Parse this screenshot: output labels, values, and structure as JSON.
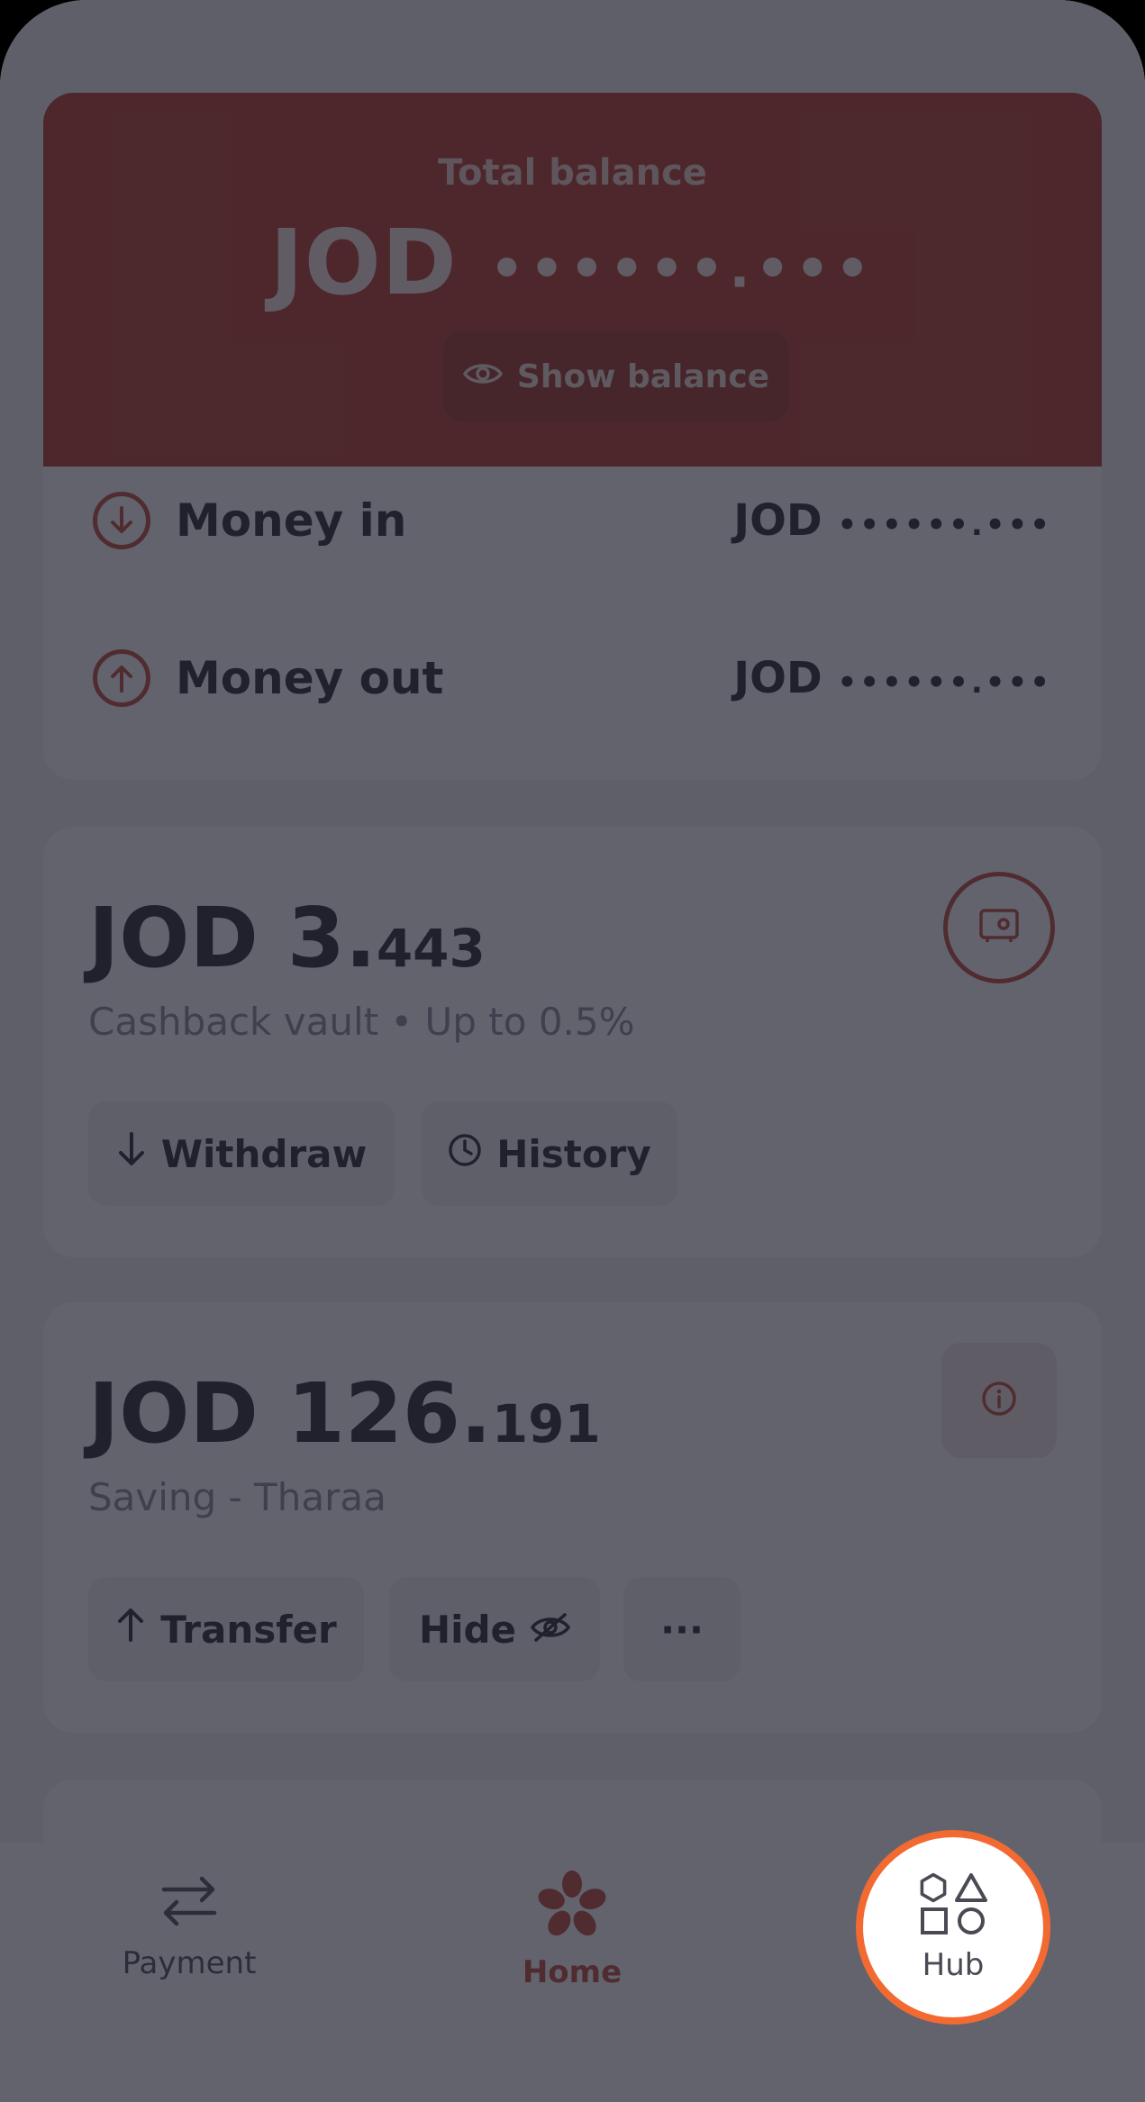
{
  "balance": {
    "label": "Total balance",
    "currency": "JOD",
    "masked": "••••••.•••",
    "show_label": "Show balance"
  },
  "flow": {
    "money_in_label": "Money in",
    "money_in_currency": "JOD",
    "money_in_masked": "••••••.•••",
    "money_out_label": "Money out",
    "money_out_currency": "JOD",
    "money_out_masked": "••••••.•••"
  },
  "vault": {
    "amount_main": "JOD 3.",
    "amount_decimals": "443",
    "subtitle": "Cashback vault • Up to 0.5%",
    "withdraw_label": "Withdraw",
    "history_label": "History"
  },
  "saving": {
    "amount_main": "JOD 126.",
    "amount_decimals": "191",
    "subtitle": "Saving - Tharaa",
    "transfer_label": "Transfer",
    "hide_label": "Hide",
    "more_label": "···"
  },
  "nav": {
    "payment": "Payment",
    "home": "Home",
    "hub": "Hub"
  },
  "colors": {
    "brand": "#b8382b",
    "highlight_ring": "#f26a31"
  }
}
